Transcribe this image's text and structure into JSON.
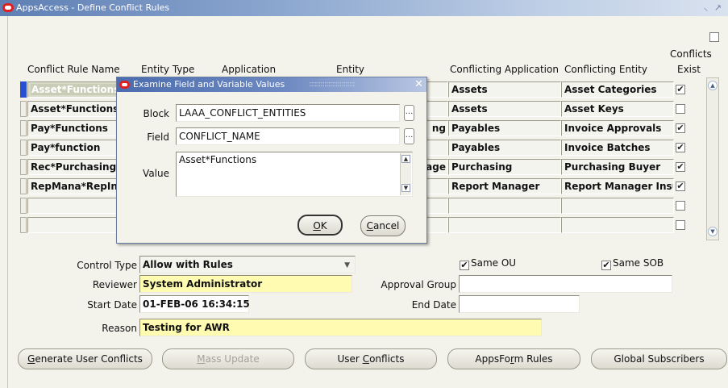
{
  "window": {
    "title": "AppsAccess - Define Conflict Rules",
    "controls": "⸜ ↗"
  },
  "table": {
    "headers": {
      "rule_name": "Conflict Rule Name",
      "entity_type": "Entity Type",
      "application": "Application",
      "entity": "Entity",
      "conflicting_application": "Conflicting Application",
      "conflicting_entity": "Conflicting Entity",
      "conflicts_exist_1": "Conflicts",
      "conflicts_exist_2": "Exist"
    },
    "rows": [
      {
        "rule_name": "Asset*Functions",
        "left_trail": "",
        "conflicting_application": "Assets",
        "conflicting_entity": "Asset Categories",
        "conflicts_exist": "✔"
      },
      {
        "rule_name": "Asset*Functions",
        "left_trail": "",
        "conflicting_application": "Assets",
        "conflicting_entity": "Asset Keys",
        "conflicts_exist": ""
      },
      {
        "rule_name": "Pay*Functions",
        "left_trail": "ng",
        "conflicting_application": "Payables",
        "conflicting_entity": "Invoice Approvals",
        "conflicts_exist": "✔"
      },
      {
        "rule_name": "Pay*function",
        "left_trail": "",
        "conflicting_application": "Payables",
        "conflicting_entity": "Invoice Batches",
        "conflicts_exist": "✔"
      },
      {
        "rule_name": "Rec*Purchasing",
        "left_trail": "age",
        "conflicting_application": "Purchasing",
        "conflicting_entity": "Purchasing Buyer",
        "conflicts_exist": "✔"
      },
      {
        "rule_name": "RepMana*RepInsu",
        "left_trail": "",
        "conflicting_application": "Report Manager",
        "conflicting_entity": "Report Manager Insur",
        "conflicts_exist": "✔"
      },
      {
        "rule_name": "",
        "left_trail": "",
        "conflicting_application": "",
        "conflicting_entity": "",
        "conflicts_exist": ""
      },
      {
        "rule_name": "",
        "left_trail": "",
        "conflicting_application": "",
        "conflicting_entity": "",
        "conflicts_exist": ""
      }
    ]
  },
  "form": {
    "control_type_label": "Control Type",
    "control_type_value": "Allow with Rules",
    "same_ou_label": "Same OU",
    "same_ou_mark": "✔",
    "same_sob_label": "Same SOB",
    "same_sob_mark": "✔",
    "reviewer_label": "Reviewer",
    "reviewer_value": "System Administrator",
    "approval_group_label": "Approval Group",
    "approval_group_value": "",
    "start_date_label": "Start Date",
    "start_date_value": "01-FEB-06 16:34:15",
    "end_date_label": "End Date",
    "end_date_value": "",
    "reason_label": "Reason",
    "reason_value": "Testing for AWR"
  },
  "buttons": {
    "generate_pre": "",
    "generate_u": "G",
    "generate_post": "enerate User Conflicts",
    "mass_pre": "",
    "mass_u": "M",
    "mass_post": "ass Update",
    "user_pre": "User ",
    "user_u": "C",
    "user_post": "onflicts",
    "appsform_pre": "AppsFo",
    "appsform_u": "r",
    "appsform_post": "m Rules",
    "global": "Global Subscribers"
  },
  "dialog": {
    "title": "Examine Field and Variable Values",
    "title_dots": "::::::::::::::::::::::::",
    "close": "✕",
    "block_label": "Block",
    "block_value": "LAAA_CONFLICT_ENTITIES",
    "field_label": "Field",
    "field_value": "CONFLICT_NAME",
    "value_label": "Value",
    "value_text": "Asset*Functions",
    "ellipsis": "...",
    "ok_u": "O",
    "ok_post": "K",
    "cancel_u": "C",
    "cancel_post": "ancel"
  }
}
